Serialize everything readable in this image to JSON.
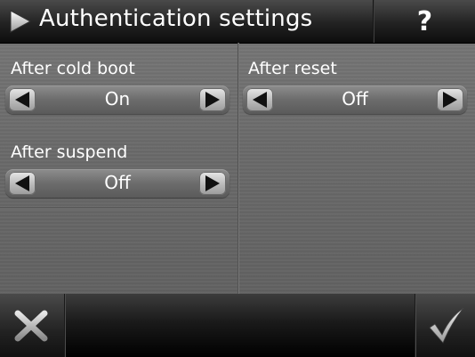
{
  "header": {
    "title": "Authentication settings",
    "help_label": "?"
  },
  "settings": [
    {
      "label": "After cold boot",
      "value": "On"
    },
    {
      "label": "After reset",
      "value": "Off"
    },
    {
      "label": "After suspend",
      "value": "Off"
    }
  ],
  "icons": {
    "title": "play-arrow-icon",
    "prev": "arrow-left-icon",
    "next": "arrow-right-icon",
    "cancel": "close-x-icon",
    "confirm": "checkmark-icon"
  },
  "colors": {
    "text": "#ffffff",
    "bar": "#111111",
    "panel": "#6b6b6b"
  }
}
